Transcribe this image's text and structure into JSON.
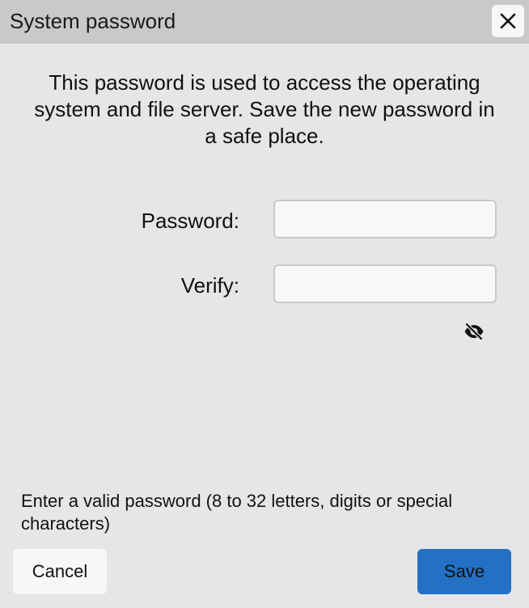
{
  "dialog": {
    "title": "System password",
    "close_icon": "close-icon",
    "description": "This password is used to access the operating system and file server. Save the new password in a safe place."
  },
  "form": {
    "password_label": "Password:",
    "password_value": "",
    "verify_label": "Verify:",
    "verify_value": "",
    "visibility_icon": "eye-off-icon"
  },
  "hint": "Enter a valid password (8 to 32 letters, digits or special characters)",
  "buttons": {
    "cancel_label": "Cancel",
    "save_label": "Save"
  },
  "colors": {
    "background": "#e6e6e6",
    "titlebar": "#c9c9c9",
    "accent": "#2370c4"
  }
}
